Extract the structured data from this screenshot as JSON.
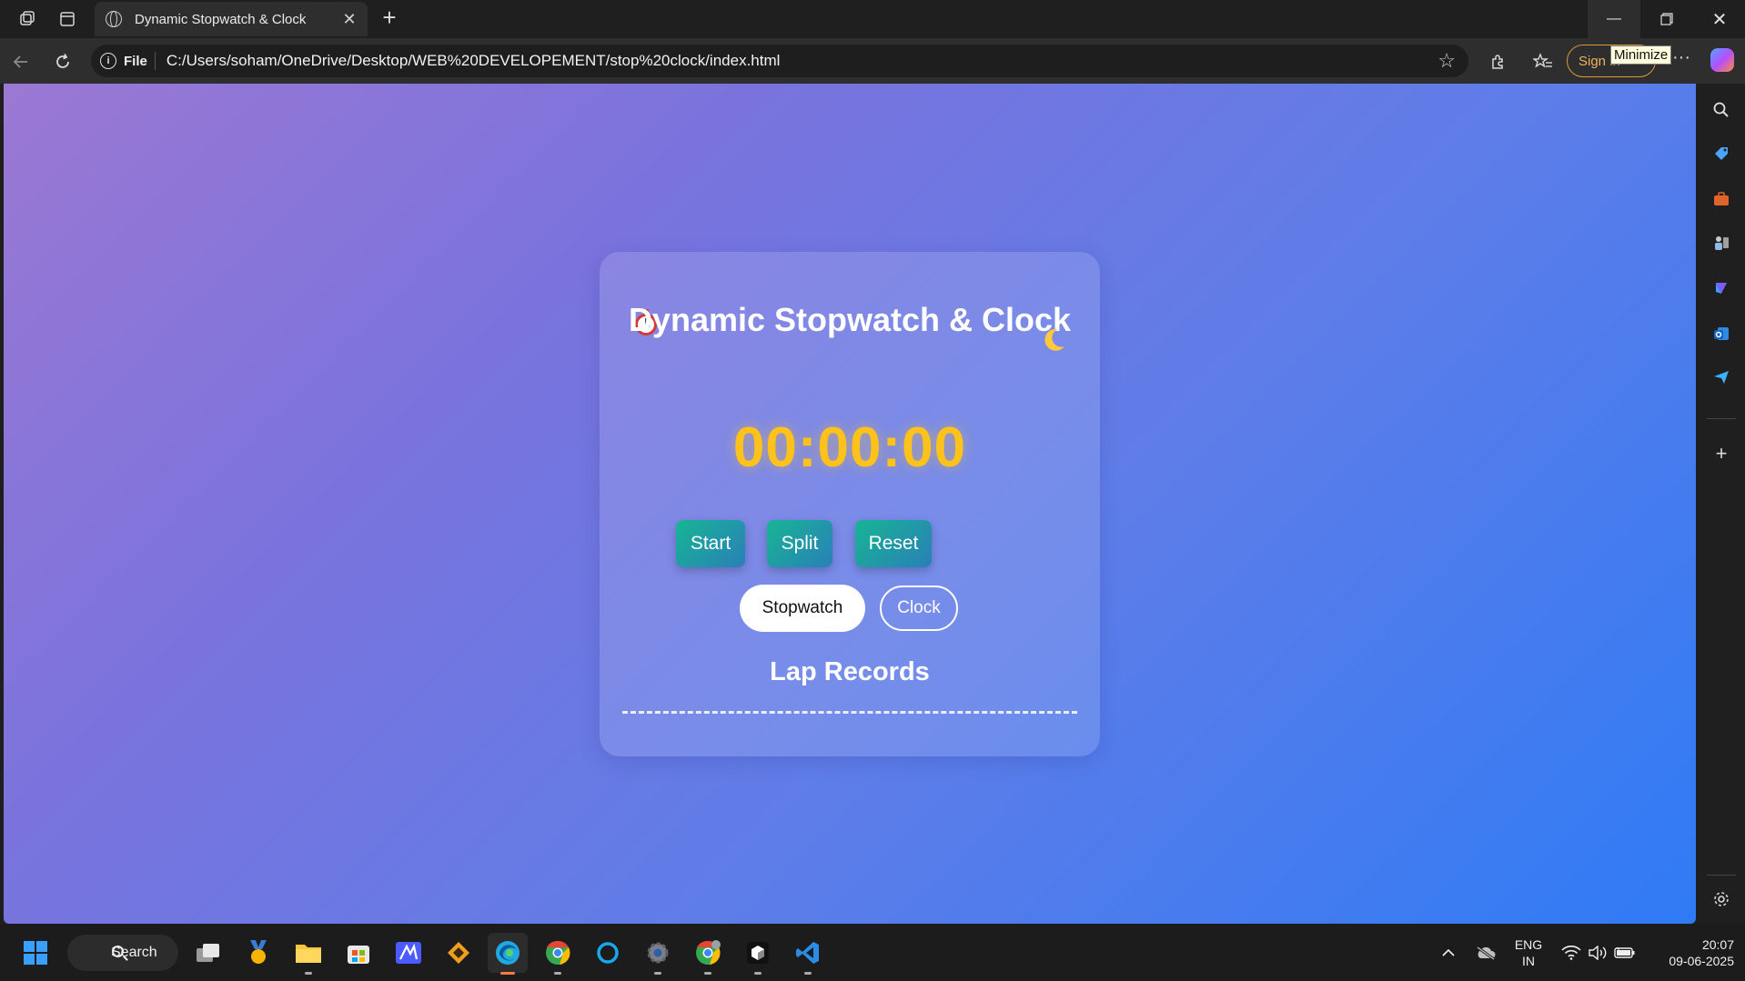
{
  "browser": {
    "tab_title": "Dynamic Stopwatch & Clock",
    "file_label": "File",
    "url": "C:/Users/soham/OneDrive/Desktop/WEB%20DEVELOPEMENT/stop%20clock/index.html",
    "sign_in_label": "Sign in",
    "tooltip": "Minimize"
  },
  "app": {
    "title": "Dynamic Stopwatch & Clock",
    "timer": "00:00:00",
    "buttons": {
      "start": "Start",
      "split": "Split",
      "reset": "Reset"
    },
    "modes": {
      "stopwatch": "Stopwatch",
      "clock": "Clock"
    },
    "mode_selected": "Stopwatch",
    "lap_title": "Lap Records",
    "colors": {
      "timer": "#ffc21a",
      "button_start": "#17b594",
      "button_end": "#2a7fb8",
      "bg_start": "#9b78d3",
      "bg_end": "#2f7bf5"
    }
  },
  "taskbar": {
    "search_label": "Search",
    "lang_line1": "ENG",
    "lang_line2": "IN",
    "time": "20:07",
    "date": "09-06-2025"
  }
}
